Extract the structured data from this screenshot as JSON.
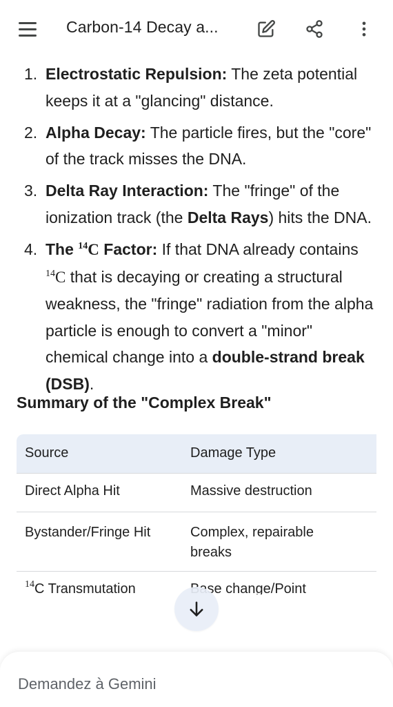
{
  "header": {
    "title": "Carbon-14 Decay a...",
    "icons": [
      "menu-icon",
      "edit-icon",
      "share-icon",
      "more-vert-icon"
    ]
  },
  "steps": [
    {
      "num": "1.",
      "bold": "Electrostatic Repulsion:",
      "text": " The zeta potential keeps it at a \"glancing\" distance."
    },
    {
      "num": "2.",
      "bold": "Alpha Decay:",
      "text": " The particle fires, but the \"core\" of the track misses the DNA."
    },
    {
      "num": "3.",
      "bold": "Delta Ray Interaction:",
      "text_a": " The \"fringe\" of the ionization track (the ",
      "bold_b": "Delta Rays",
      "text_b": ") hits the DNA."
    },
    {
      "num": "4.",
      "bold_pre": "The ",
      "iso_mass": "14",
      "iso_symbol": "C",
      "bold_post": " Factor:",
      "text_a": " If that DNA already contains ",
      "text_b": " that is decaying or creating a structural weakness, the \"fringe\" radiation from the alpha particle is enough to convert a \"minor\" chemical change into a ",
      "bold_end": "double-strand break (DSB)",
      "text_end": "."
    }
  ],
  "summary": {
    "heading": "Summary of the \"Complex Break\"",
    "columns": [
      "Source",
      "Damage Type",
      ""
    ],
    "rows": [
      [
        "Direct Alpha Hit",
        "Massive destruction",
        ""
      ],
      [
        "Bystander/Fringe Hit",
        "Complex, repairable breaks",
        ""
      ],
      [
        "C Transmutation",
        "Base change/Point",
        ""
      ]
    ],
    "row3_iso_mass": "14"
  },
  "input": {
    "placeholder": "Demandez à Gemini"
  },
  "colors": {
    "table_header_bg": "#e8eef7",
    "text": "#1f1f1f",
    "icon": "#444746",
    "placeholder": "#5f6368"
  }
}
